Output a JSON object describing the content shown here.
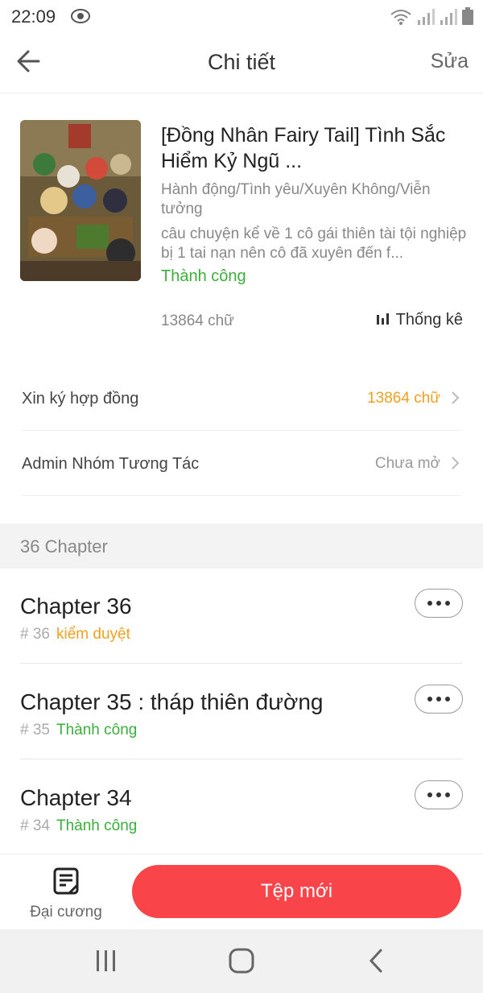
{
  "status_bar": {
    "time": "22:09"
  },
  "header": {
    "title": "Chi tiết",
    "edit_label": "Sửa"
  },
  "book": {
    "title": "[Đồng Nhân Fairy Tail] Tình Sắc Hiểm Kỷ Ngũ ...",
    "genres": "Hành động/Tình yêu/Xuyên Không/Viễn tưởng",
    "description": "câu chuyện kể về 1 cô gái thiên tài tội nghiệp bị 1 tai nạn nên cô đã xuyên đến f...",
    "status": "Thành công",
    "word_count": "13864 chữ",
    "stats_label": "Thống kê"
  },
  "settings": [
    {
      "label": "Xin ký hợp đồng",
      "value": "13864 chữ",
      "color": "#f0a020"
    },
    {
      "label": "Admin Nhóm Tương Tác",
      "value": "Chưa mở",
      "color": "#999999"
    }
  ],
  "chapters_header": "36 Chapter",
  "chapters": [
    {
      "title": "Chapter 36",
      "number": "# 36",
      "status": "kiểm duyệt",
      "status_color": "#f0a020"
    },
    {
      "title": "Chapter 35 : tháp thiên đường",
      "number": "# 35",
      "status": "Thành công",
      "status_color": "#3cae3c"
    },
    {
      "title": "Chapter 34",
      "number": "# 34",
      "status": "Thành công",
      "status_color": "#3cae3c"
    }
  ],
  "bottom_bar": {
    "outline_label": "Đại cương",
    "new_button_label": "Tệp mới"
  },
  "colors": {
    "accent": "#f94549",
    "success": "#3cae3c",
    "warning": "#f0a020"
  }
}
